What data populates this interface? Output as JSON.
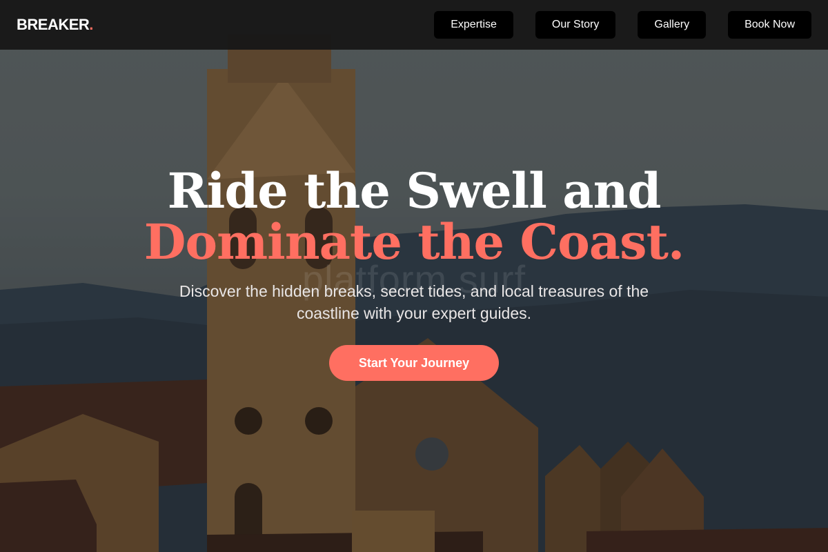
{
  "brand": {
    "name": "BREAKER",
    "dot": "."
  },
  "nav": {
    "items": [
      {
        "label": "Expertise"
      },
      {
        "label": "Our Story"
      },
      {
        "label": "Gallery"
      },
      {
        "label": "Book Now"
      }
    ]
  },
  "hero": {
    "headline_line1": "Ride the Swell and",
    "headline_line2": "Dominate the Coast.",
    "subtitle": "Discover the hidden breaks, secret tides, and local treasures of the coastline with your expert guides.",
    "cta_label": "Start Your Journey",
    "watermark": "platform.surf",
    "background_image": "church-bell-tower-hills"
  },
  "colors": {
    "accent": "#ff6f61",
    "header_bg": "#181818",
    "nav_button_bg": "#000000",
    "text_light": "#ffffff"
  }
}
